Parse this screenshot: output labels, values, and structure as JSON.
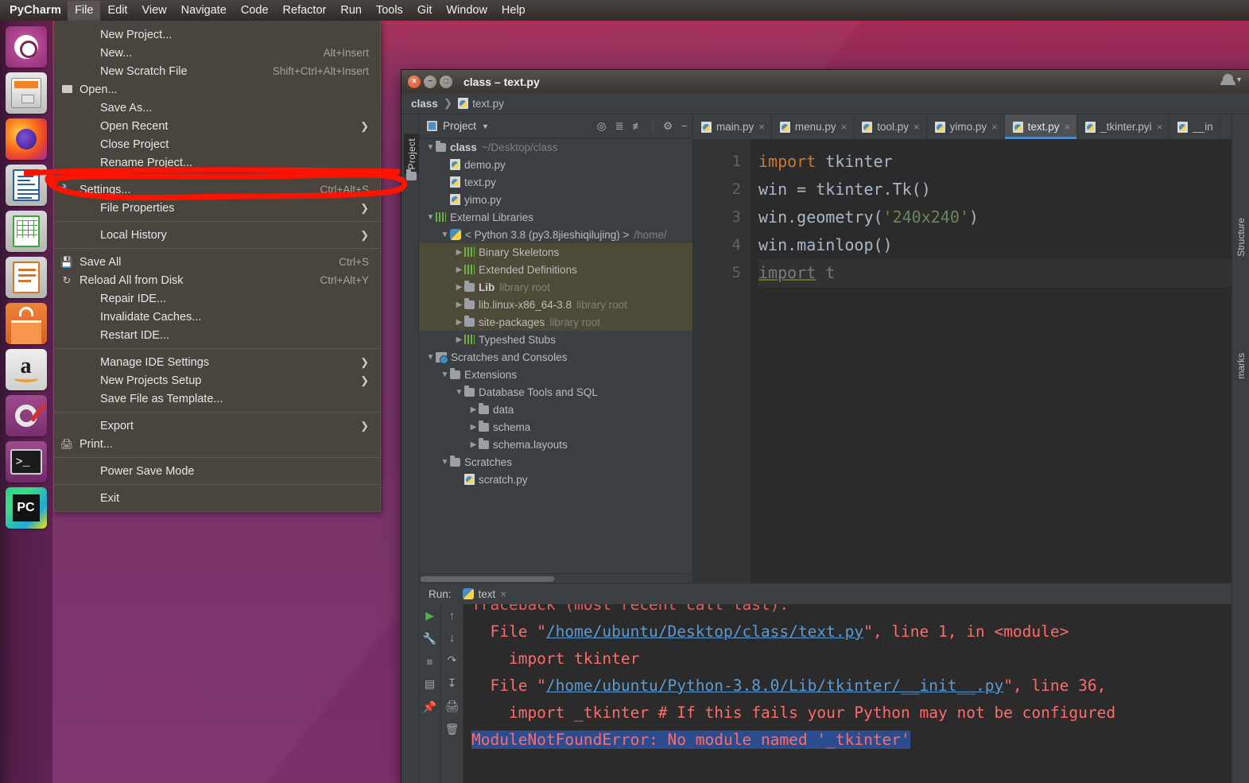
{
  "desktop": {
    "wallpaper_top_color": "#b5284f",
    "wallpaper_bottom_color": "#7c2f6b"
  },
  "top_panel": {
    "brand": "PyCharm",
    "menus": [
      {
        "label": "File",
        "active": true
      },
      {
        "label": "Edit",
        "active": false
      },
      {
        "label": "View",
        "active": false
      },
      {
        "label": "Navigate",
        "active": false
      },
      {
        "label": "Code",
        "active": false
      },
      {
        "label": "Refactor",
        "active": false
      },
      {
        "label": "Run",
        "active": false
      },
      {
        "label": "Tools",
        "active": false
      },
      {
        "label": "Git",
        "active": false
      },
      {
        "label": "Window",
        "active": false
      },
      {
        "label": "Help",
        "active": false
      }
    ]
  },
  "launcher": {
    "items": [
      {
        "name": "ubuntu-dash-icon",
        "label": "Ubuntu Dash"
      },
      {
        "name": "files-icon",
        "label": "Files"
      },
      {
        "name": "firefox-icon",
        "label": "Firefox"
      },
      {
        "name": "libreoffice-writer-icon",
        "label": "LibreOffice Writer"
      },
      {
        "name": "libreoffice-calc-icon",
        "label": "LibreOffice Calc"
      },
      {
        "name": "libreoffice-impress-icon",
        "label": "LibreOffice Impress"
      },
      {
        "name": "ubuntu-software-icon",
        "label": "Ubuntu Software"
      },
      {
        "name": "amazon-icon",
        "label": "Amazon"
      },
      {
        "name": "system-settings-icon",
        "label": "System Settings"
      },
      {
        "name": "terminal-icon",
        "label": "Terminal"
      },
      {
        "name": "pycharm-icon",
        "label": "PC"
      }
    ]
  },
  "file_menu": {
    "items": [
      {
        "label": "New Project...",
        "accel": "",
        "icon": "",
        "submenu": false
      },
      {
        "label": "New...",
        "accel": "Alt+Insert",
        "icon": "",
        "submenu": false
      },
      {
        "label": "New Scratch File",
        "accel": "Shift+Ctrl+Alt+Insert",
        "icon": "",
        "submenu": false
      },
      {
        "label": "Open...",
        "accel": "",
        "icon": "folder-icon",
        "submenu": false
      },
      {
        "label": "Save As...",
        "accel": "",
        "icon": "",
        "submenu": false
      },
      {
        "label": "Open Recent",
        "accel": "",
        "icon": "",
        "submenu": true
      },
      {
        "label": "Close Project",
        "accel": "",
        "icon": "",
        "submenu": false
      },
      {
        "label": "Rename Project...",
        "accel": "",
        "icon": "",
        "submenu": false
      },
      {
        "separator": true
      },
      {
        "label": "Settings...",
        "accel": "Ctrl+Alt+S",
        "icon": "wrench-icon",
        "submenu": false,
        "highlighted": true
      },
      {
        "label": "File Properties",
        "accel": "",
        "icon": "",
        "submenu": true
      },
      {
        "separator": true
      },
      {
        "label": "Local History",
        "accel": "",
        "icon": "",
        "submenu": true
      },
      {
        "separator": true
      },
      {
        "label": "Save All",
        "accel": "Ctrl+S",
        "icon": "save-icon",
        "submenu": false
      },
      {
        "label": "Reload All from Disk",
        "accel": "Ctrl+Alt+Y",
        "icon": "refresh-icon",
        "submenu": false
      },
      {
        "label": "Repair IDE...",
        "accel": "",
        "icon": "",
        "submenu": false
      },
      {
        "label": "Invalidate Caches...",
        "accel": "",
        "icon": "",
        "submenu": false
      },
      {
        "label": "Restart IDE...",
        "accel": "",
        "icon": "",
        "submenu": false
      },
      {
        "separator": true
      },
      {
        "label": "Manage IDE Settings",
        "accel": "",
        "icon": "",
        "submenu": true
      },
      {
        "label": "New Projects Setup",
        "accel": "",
        "icon": "",
        "submenu": true
      },
      {
        "label": "Save File as Template...",
        "accel": "",
        "icon": "",
        "submenu": false
      },
      {
        "separator": true
      },
      {
        "label": "Export",
        "accel": "",
        "icon": "",
        "submenu": true
      },
      {
        "label": "Print...",
        "accel": "",
        "icon": "printer-icon",
        "submenu": false
      },
      {
        "separator": true
      },
      {
        "label": "Power Save Mode",
        "accel": "",
        "icon": "",
        "submenu": false
      },
      {
        "separator": true
      },
      {
        "label": "Exit",
        "accel": "",
        "icon": "",
        "submenu": false
      }
    ],
    "annotation_color": "#ff1200"
  },
  "window": {
    "title": "class – text.py",
    "breadcrumb": {
      "project": "class",
      "file": "text.py"
    }
  },
  "project_panel": {
    "title": "Project",
    "vertical_tab": "Project",
    "tree": [
      {
        "indent": 0,
        "twisty": "v",
        "icon": "folder-icon",
        "label": "class",
        "bold": true,
        "dim": "~/Desktop/class",
        "hl": false
      },
      {
        "indent": 1,
        "twisty": "",
        "icon": "python-file-icon",
        "label": "demo.py",
        "bold": false,
        "dim": "",
        "hl": false
      },
      {
        "indent": 1,
        "twisty": "",
        "icon": "python-file-icon",
        "label": "text.py",
        "bold": false,
        "dim": "",
        "hl": false
      },
      {
        "indent": 1,
        "twisty": "",
        "icon": "python-file-icon",
        "label": "yimo.py",
        "bold": false,
        "dim": "",
        "hl": false
      },
      {
        "indent": 0,
        "twisty": "v",
        "icon": "library-icon",
        "label": "External Libraries",
        "bold": false,
        "dim": "",
        "hl": false
      },
      {
        "indent": 1,
        "twisty": "v",
        "icon": "python-env-icon",
        "label": "< Python 3.8 (py3.8jieshiqilujing) >",
        "bold": false,
        "dim": "/home/",
        "hl": false
      },
      {
        "indent": 2,
        "twisty": ">",
        "icon": "library-icon",
        "label": "Binary Skeletons",
        "bold": false,
        "dim": "",
        "hl": true
      },
      {
        "indent": 2,
        "twisty": ">",
        "icon": "library-icon",
        "label": "Extended Definitions",
        "bold": false,
        "dim": "",
        "hl": true
      },
      {
        "indent": 2,
        "twisty": ">",
        "icon": "folder-icon",
        "label": "Lib",
        "bold": true,
        "dim": "library root",
        "hl": true
      },
      {
        "indent": 2,
        "twisty": ">",
        "icon": "folder-icon",
        "label": "lib.linux-x86_64-3.8",
        "bold": false,
        "dim": "library root",
        "hl": true
      },
      {
        "indent": 2,
        "twisty": ">",
        "icon": "folder-icon",
        "label": "site-packages",
        "bold": false,
        "dim": "library root",
        "hl": true
      },
      {
        "indent": 2,
        "twisty": ">",
        "icon": "library-icon",
        "label": "Typeshed Stubs",
        "bold": false,
        "dim": "",
        "hl": false
      },
      {
        "indent": 0,
        "twisty": "v",
        "icon": "scratches-icon",
        "label": "Scratches and Consoles",
        "bold": false,
        "dim": "",
        "hl": false
      },
      {
        "indent": 1,
        "twisty": "v",
        "icon": "folder-icon",
        "label": "Extensions",
        "bold": false,
        "dim": "",
        "hl": false
      },
      {
        "indent": 2,
        "twisty": "v",
        "icon": "folder-icon",
        "label": "Database Tools and SQL",
        "bold": false,
        "dim": "",
        "hl": false
      },
      {
        "indent": 3,
        "twisty": ">",
        "icon": "folder-icon",
        "label": "data",
        "bold": false,
        "dim": "",
        "hl": false
      },
      {
        "indent": 3,
        "twisty": ">",
        "icon": "folder-icon",
        "label": "schema",
        "bold": false,
        "dim": "",
        "hl": false
      },
      {
        "indent": 3,
        "twisty": ">",
        "icon": "folder-icon",
        "label": "schema.layouts",
        "bold": false,
        "dim": "",
        "hl": false
      },
      {
        "indent": 1,
        "twisty": "v",
        "icon": "folder-icon",
        "label": "Scratches",
        "bold": false,
        "dim": "",
        "hl": false
      },
      {
        "indent": 2,
        "twisty": "",
        "icon": "scratch-file-icon",
        "label": "scratch.py",
        "bold": false,
        "dim": "",
        "hl": false
      }
    ],
    "toolbar_icons": [
      "locate-icon",
      "expand-all-icon",
      "collapse-all-icon",
      "gear-icon",
      "hide-icon"
    ]
  },
  "editor": {
    "tabs": [
      {
        "label": "main.py",
        "active": false
      },
      {
        "label": "menu.py",
        "active": false
      },
      {
        "label": "tool.py",
        "active": false
      },
      {
        "label": "yimo.py",
        "active": false
      },
      {
        "label": "text.py",
        "active": true
      },
      {
        "label": "_tkinter.pyi",
        "active": false
      },
      {
        "label": "__in",
        "active": false
      }
    ],
    "line_numbers": [
      "1",
      "2",
      "3",
      "4",
      "5"
    ],
    "code_lines": [
      "import tkinter",
      "win = tkinter.Tk()",
      "win.geometry('240x240')",
      "win.mainloop()",
      "import t"
    ]
  },
  "run_panel": {
    "label": "Run:",
    "tab": "text",
    "toolbar_left": [
      "run-icon",
      "wrench-icon",
      "stop-icon",
      "layout-icon",
      "pin-icon"
    ],
    "toolbar_right": [
      "scroll-up-icon",
      "scroll-down-icon",
      "soft-wrap-icon",
      "scroll-end-icon",
      "print-icon",
      "trash-icon"
    ],
    "console_lines": [
      {
        "text": "Traceback (most recent call last):",
        "type": "clipped"
      },
      {
        "prefix": "  File \"",
        "link": "/home/ubuntu/Desktop/class/text.py",
        "suffix": "\", line 1, in <module>"
      },
      {
        "text": "    import tkinter"
      },
      {
        "prefix": "  File \"",
        "link": "/home/ubuntu/Python-3.8.0/Lib/tkinter/__init__.py",
        "suffix": "\", line 36, "
      },
      {
        "text": "    import _tkinter # If this fails your Python may not be configured"
      },
      {
        "text": "ModuleNotFoundError: No module named '_tkinter'",
        "selected": true
      }
    ],
    "selection_color": "#2b4d8f"
  },
  "right_stripe": {
    "structure": "Structure",
    "bookmarks": "marks"
  }
}
